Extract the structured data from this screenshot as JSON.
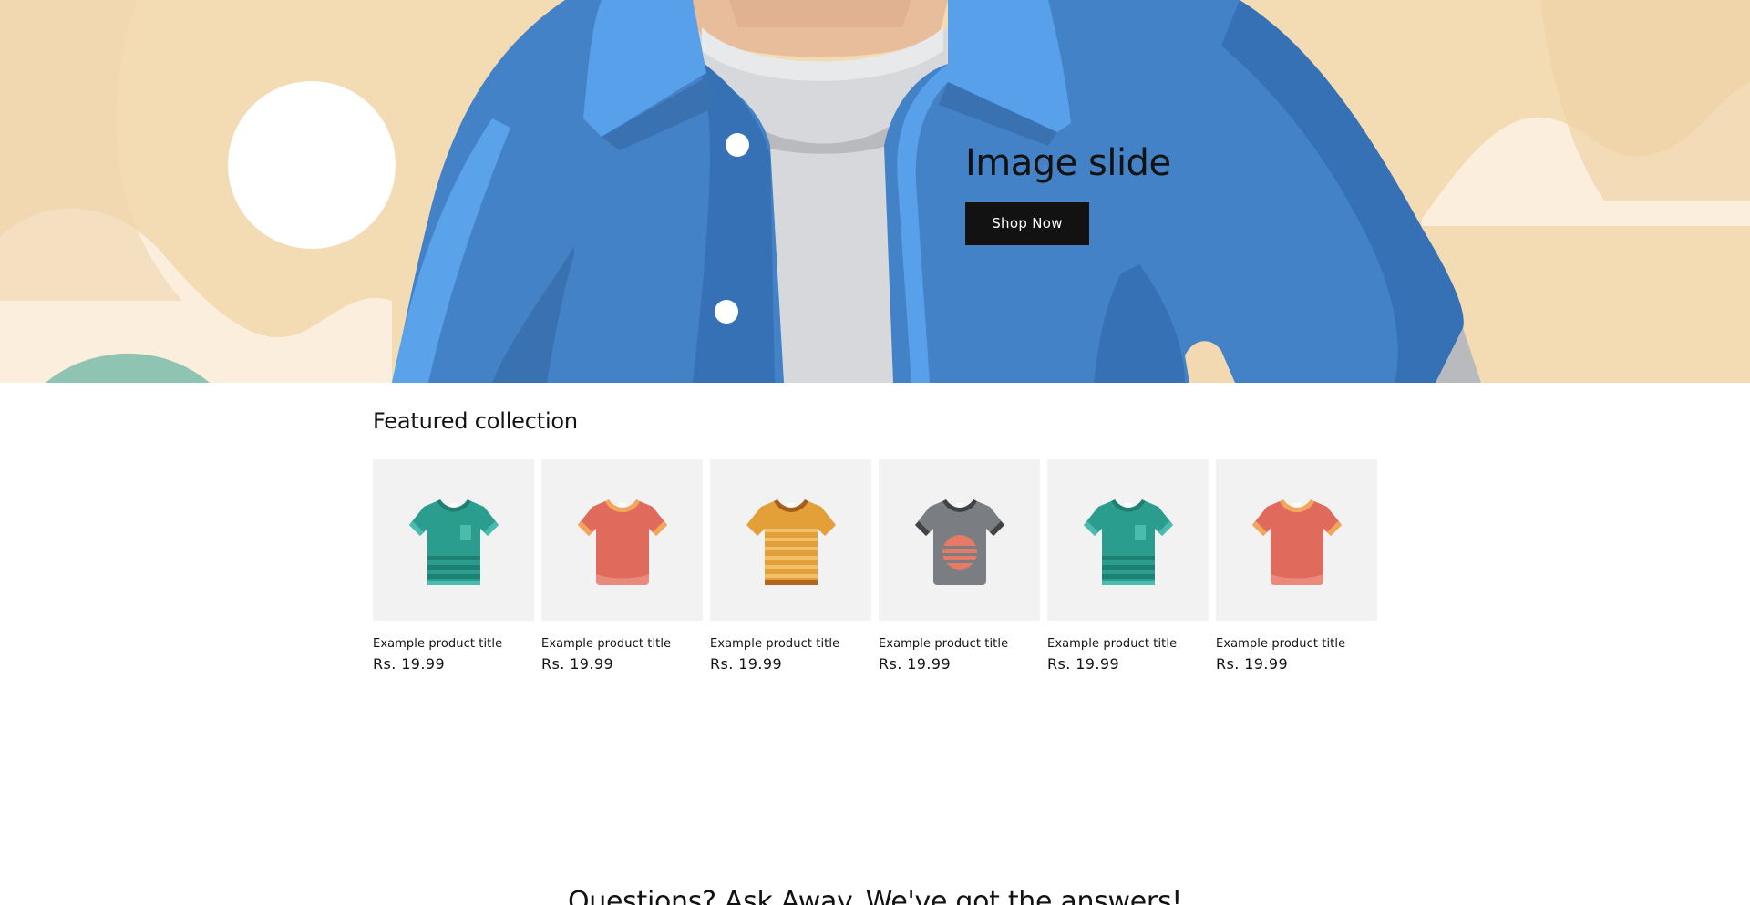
{
  "hero": {
    "title": "Image slide",
    "button_label": "Shop Now"
  },
  "featured": {
    "heading": "Featured collection",
    "products": [
      {
        "title": "Example product title",
        "price": "Rs. 19.99",
        "icon": "teal-striped-tshirt-icon"
      },
      {
        "title": "Example product title",
        "price": "Rs. 19.99",
        "icon": "coral-tshirt-icon"
      },
      {
        "title": "Example product title",
        "price": "Rs. 19.99",
        "icon": "yellow-striped-tshirt-icon"
      },
      {
        "title": "Example product title",
        "price": "Rs. 19.99",
        "icon": "grey-sunset-tshirt-icon"
      },
      {
        "title": "Example product title",
        "price": "Rs. 19.99",
        "icon": "teal-striped-tshirt-icon"
      },
      {
        "title": "Example product title",
        "price": "Rs. 19.99",
        "icon": "coral-tshirt-icon"
      }
    ]
  },
  "faq": {
    "heading": "Questions? Ask Away. We've got the answers!"
  },
  "colors": {
    "hero_background": "#f3dbb3",
    "jacket": "#4382c7",
    "button": "#121212",
    "card_background": "#f2f2f2"
  }
}
